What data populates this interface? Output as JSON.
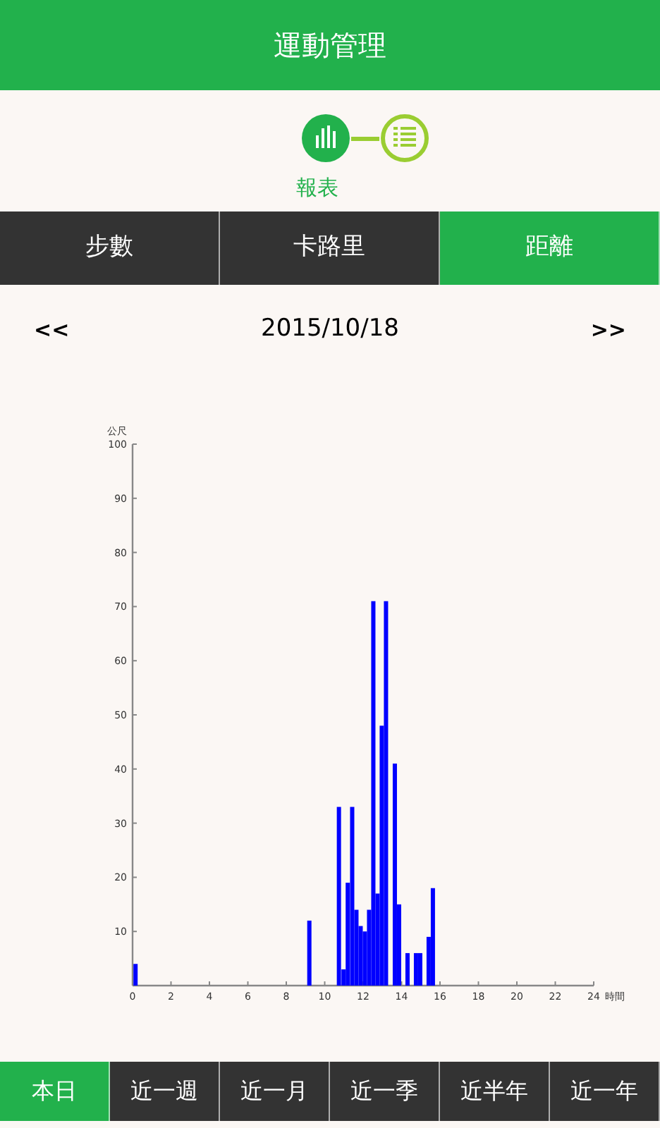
{
  "header": {
    "title": "運動管理"
  },
  "view_switch": {
    "items": [
      {
        "kind": "chart",
        "selected": true
      },
      {
        "kind": "list",
        "selected": false
      }
    ],
    "label": "報表"
  },
  "metric_tabs": [
    {
      "label": "步數",
      "selected": false
    },
    {
      "label": "卡路里",
      "selected": false
    },
    {
      "label": "距離",
      "selected": true
    }
  ],
  "date_nav": {
    "prev": "<<",
    "date": "2015/10/18",
    "next": ">>"
  },
  "chart": {
    "chart_data": {
      "type": "bar",
      "xlabel": "時間",
      "ylabel": "公尺",
      "xlim": [
        0,
        24
      ],
      "ylim": [
        0,
        100
      ],
      "xticks": [
        0,
        2,
        4,
        6,
        8,
        10,
        12,
        14,
        16,
        18,
        20,
        22,
        24
      ],
      "yticks": [
        10,
        20,
        30,
        40,
        50,
        60,
        70,
        80,
        90,
        100
      ],
      "x": [
        0.05,
        9.2,
        10.74,
        10.98,
        11.2,
        11.43,
        11.65,
        11.87,
        12.09,
        12.31,
        12.53,
        12.75,
        12.97,
        13.19,
        13.65,
        13.87,
        14.31,
        14.75,
        14.97,
        15.41,
        15.63
      ],
      "series": [
        {
          "color": "#0000ff",
          "values": [
            4,
            12,
            33,
            3,
            19,
            33,
            14,
            11,
            10,
            14,
            71,
            17,
            48,
            71,
            41,
            15,
            6,
            6,
            6,
            9,
            18
          ]
        }
      ]
    }
  },
  "range_tabs": [
    {
      "label": "本日",
      "selected": true
    },
    {
      "label": "近一週",
      "selected": false
    },
    {
      "label": "近一月",
      "selected": false
    },
    {
      "label": "近一季",
      "selected": false
    },
    {
      "label": "近半年",
      "selected": false
    },
    {
      "label": "近一年",
      "selected": false
    }
  ]
}
